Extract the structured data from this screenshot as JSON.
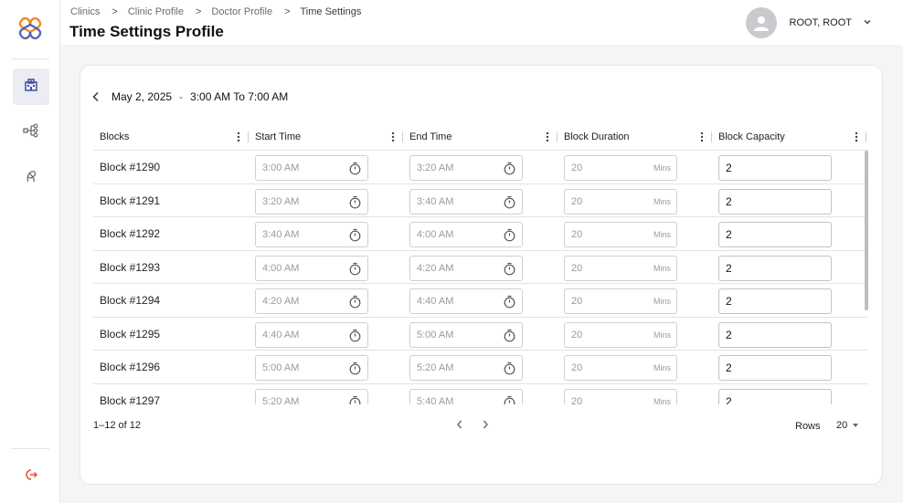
{
  "breadcrumb": [
    "Clinics",
    "Clinic Profile",
    "Doctor Profile",
    "Time Settings"
  ],
  "breadcrumb_separator": ">",
  "page_title": "Time Settings Profile",
  "user": {
    "name": "ROOT, ROOT"
  },
  "sidebar": {
    "items": [
      {
        "icon": "hospital-icon",
        "active": true
      },
      {
        "icon": "hierarchy-icon",
        "active": false
      },
      {
        "icon": "ribbon-icon",
        "active": false
      }
    ],
    "logout_icon": "logout-icon"
  },
  "date_nav": {
    "date": "May 2, 2025",
    "separator": "-",
    "range": "3:00 AM To 7:00 AM"
  },
  "table": {
    "columns": [
      "Blocks",
      "Start Time",
      "End Time",
      "Block Duration",
      "Block Capacity"
    ],
    "unit": "Mins",
    "rows": [
      {
        "block": "Block #1290",
        "start": "3:00 AM",
        "end": "3:20 AM",
        "duration": "20",
        "capacity": "2"
      },
      {
        "block": "Block #1291",
        "start": "3:20 AM",
        "end": "3:40 AM",
        "duration": "20",
        "capacity": "2"
      },
      {
        "block": "Block #1292",
        "start": "3:40 AM",
        "end": "4:00 AM",
        "duration": "20",
        "capacity": "2"
      },
      {
        "block": "Block #1293",
        "start": "4:00 AM",
        "end": "4:20 AM",
        "duration": "20",
        "capacity": "2"
      },
      {
        "block": "Block #1294",
        "start": "4:20 AM",
        "end": "4:40 AM",
        "duration": "20",
        "capacity": "2"
      },
      {
        "block": "Block #1295",
        "start": "4:40 AM",
        "end": "5:00 AM",
        "duration": "20",
        "capacity": "2"
      },
      {
        "block": "Block #1296",
        "start": "5:00 AM",
        "end": "5:20 AM",
        "duration": "20",
        "capacity": "2"
      },
      {
        "block": "Block #1297",
        "start": "5:20 AM",
        "end": "5:40 AM",
        "duration": "20",
        "capacity": "2"
      }
    ]
  },
  "pagination": {
    "info": "1–12 of 12",
    "rows_label": "Rows",
    "rows_value": "20"
  },
  "colors": {
    "accent": "#f08a24",
    "brand_blue": "#3b4fa8",
    "logout_red": "#e0523f"
  }
}
